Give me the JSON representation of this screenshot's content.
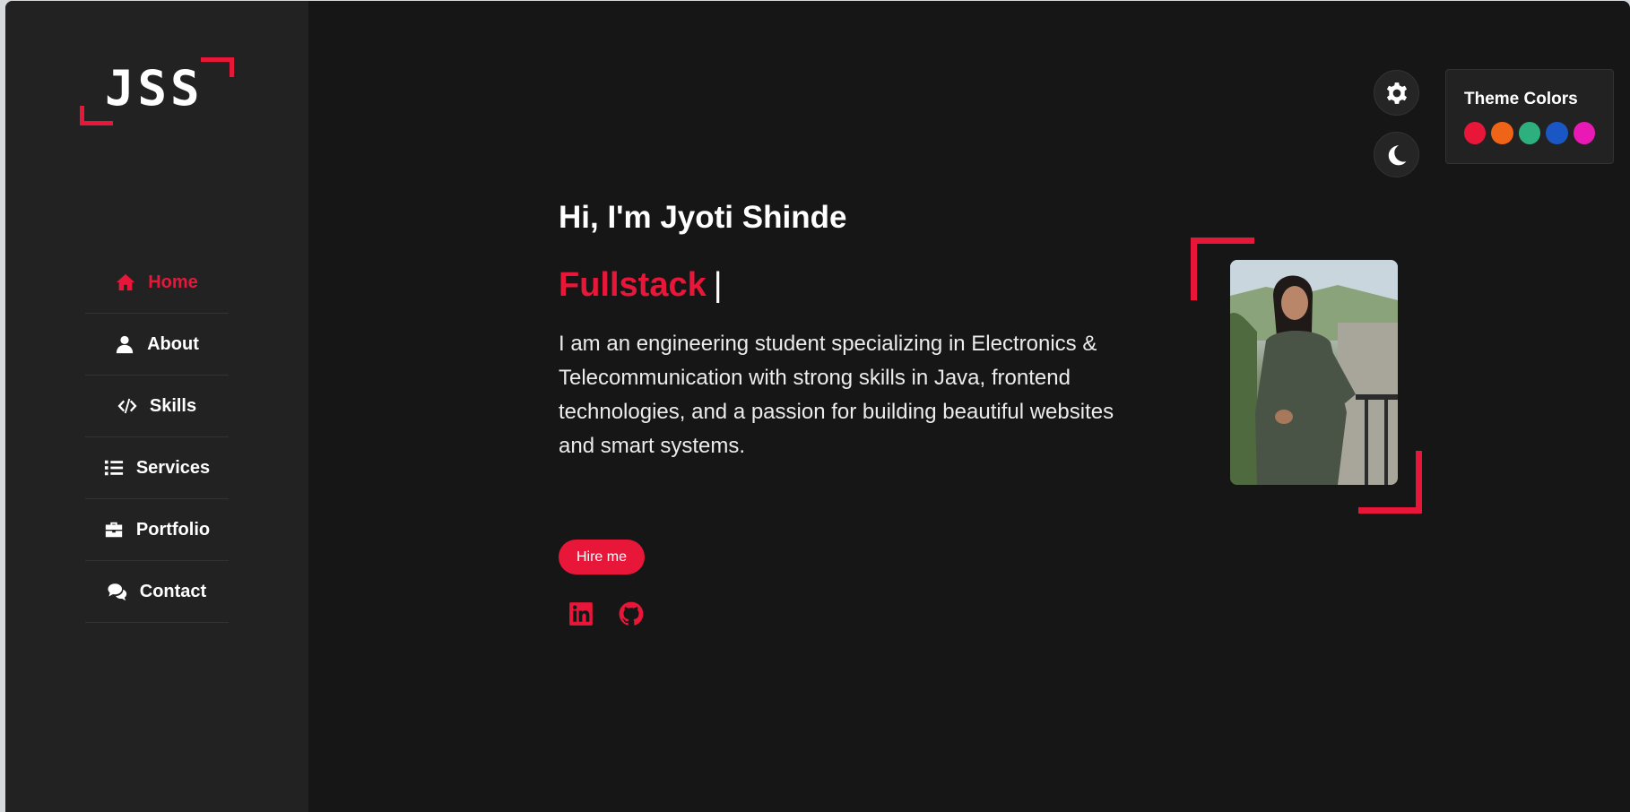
{
  "logo": {
    "text": "JSS"
  },
  "sidebar": {
    "items": [
      {
        "label": "Home",
        "icon": "home-icon",
        "active": true
      },
      {
        "label": "About",
        "icon": "user-icon",
        "active": false
      },
      {
        "label": "Skills",
        "icon": "code-icon",
        "active": false
      },
      {
        "label": "Services",
        "icon": "list-icon",
        "active": false
      },
      {
        "label": "Portfolio",
        "icon": "briefcase-icon",
        "active": false
      },
      {
        "label": "Contact",
        "icon": "comments-icon",
        "active": false
      }
    ]
  },
  "hero": {
    "greeting": "Hi, I'm Jyoti Shinde",
    "role": "Fullstack",
    "cursor": "|",
    "bio": "I am an engineering student specializing in Electronics & Telecommunication with strong skills in Java, frontend technologies, and a passion for building beautiful websites and smart systems.",
    "hire_label": "Hire me",
    "social": [
      "linkedin-icon",
      "github-icon"
    ]
  },
  "theme": {
    "title": "Theme Colors",
    "swatches": [
      "#e8173a",
      "#f06418",
      "#2eb07e",
      "#1a56c4",
      "#e819b5"
    ],
    "accent": "#e8173a"
  },
  "controls": {
    "settings_icon": "gear-icon",
    "mode_icon": "moon-icon"
  }
}
